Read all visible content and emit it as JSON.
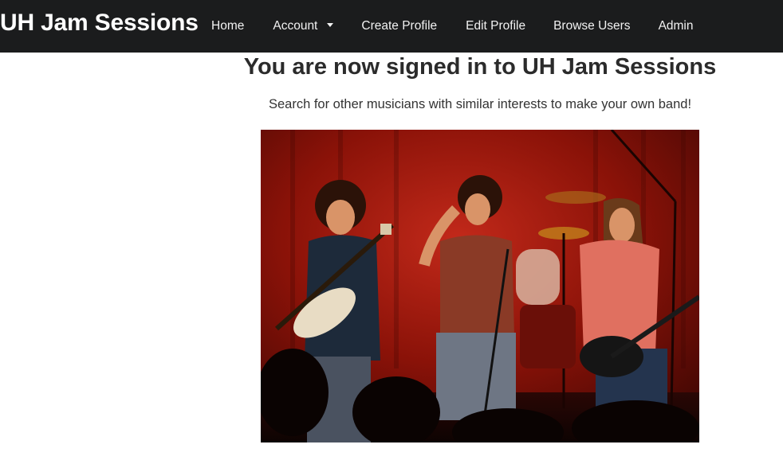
{
  "navbar": {
    "brand": "UH Jam Sessions",
    "items": [
      {
        "label": "Home"
      },
      {
        "label": "Account",
        "has_dropdown": true
      },
      {
        "label": "Create Profile"
      },
      {
        "label": "Edit Profile"
      },
      {
        "label": "Browse Users"
      },
      {
        "label": "Admin"
      }
    ],
    "background": "#1b1c1d"
  },
  "main": {
    "title": "You are now signed in to UH Jam Sessions",
    "subtitle": "Search for other musicians with similar interests to make your own band!",
    "image": {
      "icon": "band-photo"
    }
  }
}
